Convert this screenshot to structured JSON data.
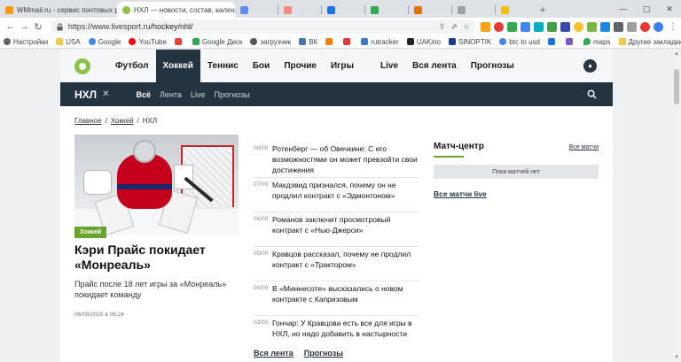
{
  "browser": {
    "tabs": [
      {
        "title": "WMmail.ru - сервис почтовых рас",
        "favicon_color": "#f29b1d",
        "active": false
      },
      {
        "title": "НХЛ — новости, состав, календарь",
        "favicon_color": "#8bc34a",
        "active": true
      },
      {
        "title": "",
        "favicon_color": "#5b8def",
        "active": false
      },
      {
        "title": "",
        "favicon_color": "#f28b82",
        "active": false
      },
      {
        "title": "",
        "favicon_color": "#1a73e8",
        "active": false
      },
      {
        "title": "",
        "favicon_color": "#34a853",
        "active": false
      },
      {
        "title": "",
        "favicon_color": "#e37400",
        "active": false
      },
      {
        "title": "",
        "favicon_color": "#9aa0a6",
        "active": false
      },
      {
        "title": "",
        "favicon_color": "#fbbc04",
        "active": false
      },
      {
        "title": "",
        "favicon_color": "#ea4335",
        "active": false
      },
      {
        "title": "",
        "favicon_color": "#1a73e8",
        "active": false
      }
    ],
    "url_host": "https://www.livesport.ru",
    "url_path": "/hockey/nhl/",
    "bookmarks": [
      {
        "label": "Настройки",
        "color": "#5f6368",
        "folder": false
      },
      {
        "label": "USA",
        "color": "#f2c94c",
        "folder": true
      },
      {
        "label": "Google",
        "color": "#4285f4",
        "folder": false
      },
      {
        "label": "YouTube",
        "color": "#ff0000",
        "folder": false
      },
      {
        "label": "",
        "color": "#ea4335",
        "folder": false
      },
      {
        "label": "Google Диск",
        "color": "#34a853",
        "folder": false
      },
      {
        "label": "загрузчик",
        "color": "#555555",
        "folder": false
      },
      {
        "label": "ВК",
        "color": "#4a76a8",
        "folder": false
      },
      {
        "label": "",
        "color": "#f57c00",
        "folder": false
      },
      {
        "label": "",
        "color": "#e53935",
        "folder": false
      },
      {
        "label": "rutracker",
        "color": "#3e7bbf",
        "folder": false
      },
      {
        "label": "UAKino",
        "color": "#222222",
        "folder": false
      },
      {
        "label": "SINOPTIK",
        "color": "#1e3a8a",
        "folder": false
      },
      {
        "label": "btc to usd",
        "color": "#4285f4",
        "folder": false
      },
      {
        "label": "",
        "color": "#1a73e8",
        "folder": false
      },
      {
        "label": "",
        "color": "#7e57c2",
        "folder": false
      },
      {
        "label": "maps",
        "color": "#34a853",
        "folder": false
      }
    ],
    "bookmarks_other": "Другие закладки"
  },
  "site": {
    "nav": [
      "Футбол",
      "Хоккей",
      "Теннис",
      "Бои",
      "Прочие",
      "Игры"
    ],
    "nav_active": 1,
    "nav_extra": [
      "Live",
      "Вся лента",
      "Прогнозы"
    ],
    "league": "НХЛ",
    "subnav": [
      "Всё",
      "Лента",
      "Live",
      "Прогнозы"
    ],
    "subnav_active": 0
  },
  "breadcrumb": [
    "Главное",
    "Хоккей",
    "НХЛ"
  ],
  "hero": {
    "tag": "Хоккей",
    "title": "Кэри Прайс покидает «Монреаль»",
    "lead": "Прайс после 18 лет игры за «Монреаль» покидает команду",
    "date": "06/09/2025 в 08:24"
  },
  "news": [
    {
      "date": "08/09",
      "title": "Ротенберг — об Овечкине: С его возможностями он может превзойти свои достижения"
    },
    {
      "date": "07/09",
      "title": "Макдэвид признался, почему он не продлил контракт с «Эдмонтоном»"
    },
    {
      "date": "06/09",
      "title": "Романов заключит просмотровый контракт с «Нью-Джерси»"
    },
    {
      "date": "05/09",
      "title": "Кравцов рассказал, почему не продлил контракт с «Трактором»"
    },
    {
      "date": "04/09",
      "title": "В «Миннесоте» высказались о новом контракте с Капризовым"
    },
    {
      "date": "03/09",
      "title": "Гончар: У Кравцова есть все для игры в НХЛ, но надо добавить в настырности"
    }
  ],
  "news_links": [
    "Вся лента",
    "Прогнозы"
  ],
  "match_center": {
    "title": "Матч-центр",
    "all_link": "Все матчи",
    "empty": "Пока матчей нет",
    "live_link": "Все матчи live"
  },
  "colors": {
    "dark": "#243340",
    "accent": "#6aa32f"
  }
}
